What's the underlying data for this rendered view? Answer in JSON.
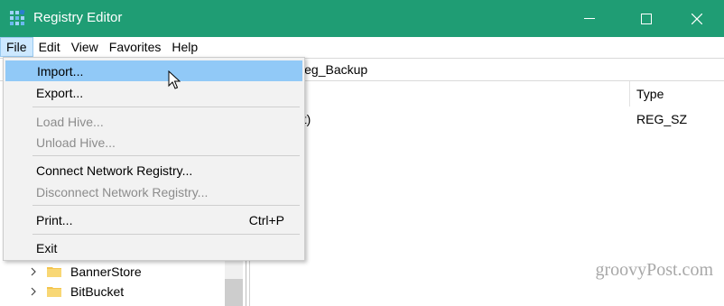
{
  "window": {
    "title": "Registry Editor",
    "accent": "#1f9d74"
  },
  "menubar": {
    "items": [
      {
        "label": "File"
      },
      {
        "label": "Edit"
      },
      {
        "label": "View"
      },
      {
        "label": "Favorites"
      },
      {
        "label": "Help"
      }
    ]
  },
  "address": {
    "visible_path": "rosoft\\Windows\\CurrentVersion\\Explorer\\Advanced\\Reg_Backup"
  },
  "values": {
    "type_header": "Type",
    "rows": [
      {
        "name_partial": "ault)",
        "type": "REG_SZ"
      }
    ]
  },
  "tree": {
    "items": [
      {
        "label": "BannerStore"
      },
      {
        "label": "BitBucket"
      }
    ]
  },
  "file_menu": {
    "items": [
      {
        "label": "Import...",
        "shortcut": "",
        "disabled": false,
        "highlighted": true
      },
      {
        "label": "Export...",
        "shortcut": "",
        "disabled": false
      },
      {
        "label": "Load Hive...",
        "shortcut": "",
        "disabled": true
      },
      {
        "label": "Unload Hive...",
        "shortcut": "",
        "disabled": true
      },
      {
        "label": "Connect Network Registry...",
        "shortcut": "",
        "disabled": false
      },
      {
        "label": "Disconnect Network Registry...",
        "shortcut": "",
        "disabled": true
      },
      {
        "label": "Print...",
        "shortcut": "Ctrl+P",
        "disabled": false
      },
      {
        "label": "Exit",
        "shortcut": "",
        "disabled": false
      }
    ]
  },
  "watermark": {
    "text": "groovyPost.com"
  }
}
